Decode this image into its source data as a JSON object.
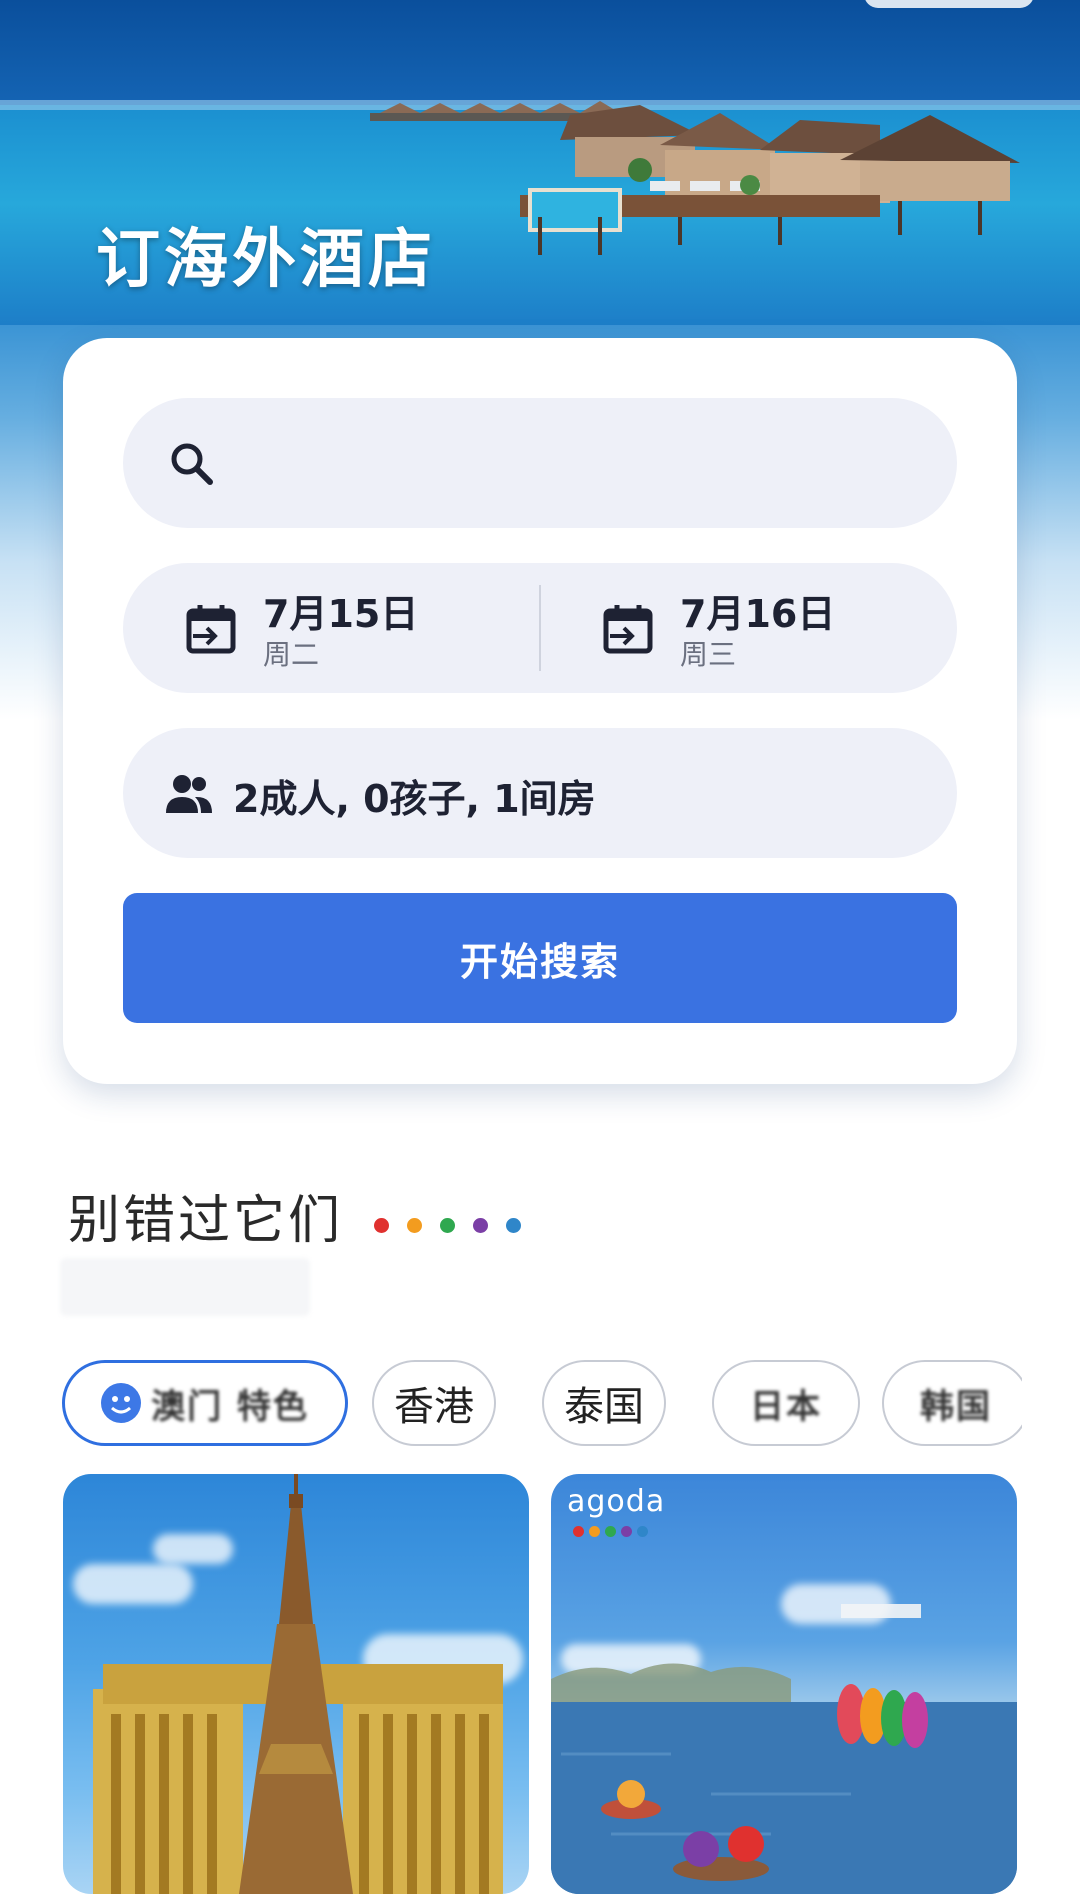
{
  "hero": {
    "title": "订海外酒店"
  },
  "search": {
    "placeholder": ""
  },
  "dates": {
    "checkin": {
      "date": "7月15日",
      "weekday": "周二"
    },
    "checkout": {
      "date": "7月16日",
      "weekday": "周三"
    }
  },
  "guests": {
    "summary": "2成人, 0孩子, 1间房"
  },
  "search_button": {
    "label": "开始搜索"
  },
  "section": {
    "title": "别错过它们",
    "dot_colors": [
      "#e0312f",
      "#f39c1f",
      "#2fa84f",
      "#7b3fa6",
      "#2f86c9"
    ]
  },
  "chips": [
    {
      "label": "澳门 特色",
      "active": true
    },
    {
      "label": "香港",
      "active": false
    },
    {
      "label": "泰国",
      "active": false
    },
    {
      "label": "日本",
      "active": false
    },
    {
      "label": "韩国",
      "active": false
    }
  ],
  "cards": [
    {
      "image": "paris-tower-hotel"
    },
    {
      "image": "lake-scene",
      "brand": "agoda"
    }
  ],
  "colors": {
    "accent": "#3a72e1",
    "field_bg": "#eef0f8"
  }
}
